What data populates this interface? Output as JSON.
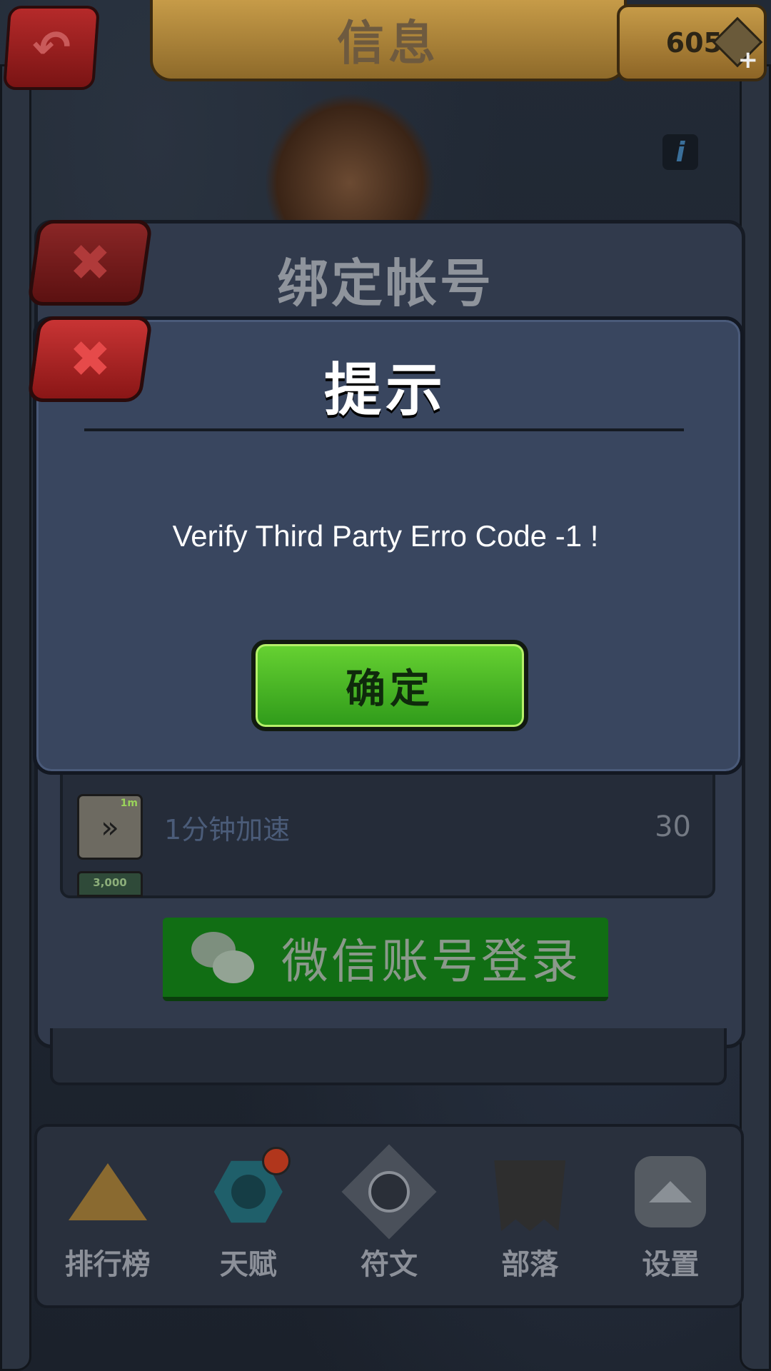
{
  "header": {
    "title": "信息",
    "gems": "605"
  },
  "bind_panel": {
    "title": "绑定帐号"
  },
  "list": {
    "items": [
      {
        "icon_tag": "1m",
        "name": "1分钟加速",
        "value": "30"
      },
      {
        "icon_tag": "3,000"
      }
    ]
  },
  "wechat_button": {
    "label": "微信账号登录"
  },
  "dialog": {
    "title": "提示",
    "message": "Verify Third Party Erro Code -1 !",
    "ok_label": "确定"
  },
  "nav": {
    "items": [
      {
        "label": "排行榜",
        "icon": "crown-icon"
      },
      {
        "label": "天赋",
        "icon": "talent-icon"
      },
      {
        "label": "符文",
        "icon": "rune-icon"
      },
      {
        "label": "部落",
        "icon": "tribe-flag-icon"
      },
      {
        "label": "设置",
        "icon": "gear-icon"
      }
    ]
  },
  "colors": {
    "confirm_green": "#3fae1f",
    "wechat_green": "#116e14",
    "close_red": "#b52a2a",
    "panel": "#39465f"
  }
}
